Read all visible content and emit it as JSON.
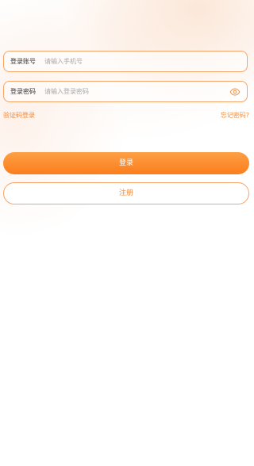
{
  "form": {
    "account": {
      "label": "登录账号",
      "value": "",
      "placeholder": "请输入手机号"
    },
    "password": {
      "label": "登录密码",
      "value": "",
      "placeholder": "请输入登录密码",
      "toggle_icon": "eye-icon"
    }
  },
  "links": {
    "sms_login": "验证码登录",
    "forgot_password": "忘记密码?"
  },
  "buttons": {
    "login": "登录",
    "register": "注册"
  },
  "colors": {
    "accent": "#fb8a2c",
    "border": "#f5a46a",
    "link": "#f08a3c"
  }
}
